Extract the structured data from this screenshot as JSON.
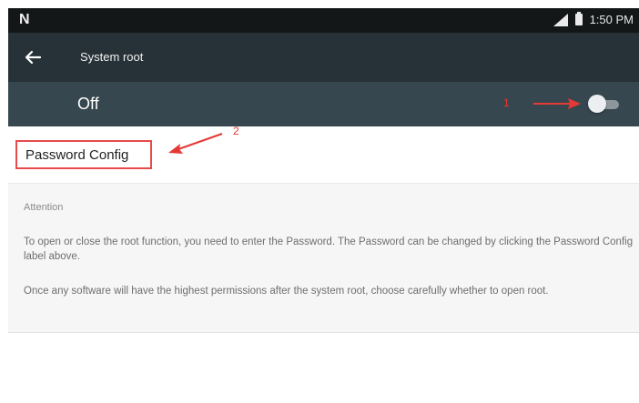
{
  "status_bar": {
    "logo": "N",
    "time": "1:50 PM"
  },
  "toolbar": {
    "title": "System root",
    "back_icon": "arrow-back-icon"
  },
  "root_switch": {
    "label": "Off",
    "checked": false
  },
  "password_config": {
    "label": "Password Config"
  },
  "annotations": {
    "marker_1": "1",
    "marker_2": "2",
    "color": "#e53935"
  },
  "info": {
    "heading": "Attention",
    "paragraphs": [
      "To open or close the root function, you need to enter the Password. The Password can be changed by clicking the Password Config label above.",
      "Once any software will have the highest permissions after the system root, choose carefully whether to open root."
    ]
  },
  "colors": {
    "status_bar": "#141718",
    "toolbar": "#263238",
    "switch_bar": "#37474f",
    "highlight_box": "#e84a4a"
  }
}
